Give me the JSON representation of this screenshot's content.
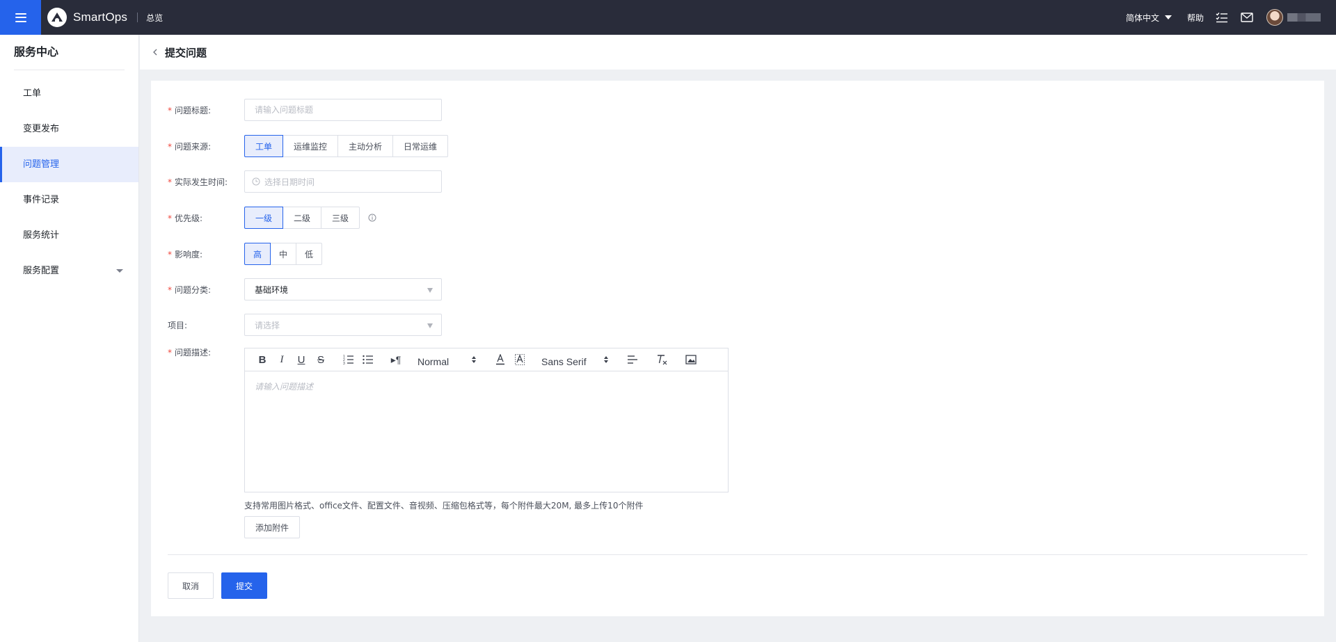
{
  "topbar": {
    "app_name": "SmartOps",
    "nav_overview": "总览",
    "language": "简体中文",
    "help": "帮助"
  },
  "sidebar": {
    "title": "服务中心",
    "items": [
      {
        "label": "工单"
      },
      {
        "label": "变更发布"
      },
      {
        "label": "问题管理"
      },
      {
        "label": "事件记录"
      },
      {
        "label": "服务统计"
      },
      {
        "label": "服务配置"
      }
    ]
  },
  "page": {
    "title": "提交问题"
  },
  "form": {
    "title_label": "问题标题:",
    "title_placeholder": "请输入问题标题",
    "source_label": "问题来源:",
    "source_options": [
      "工单",
      "运维监控",
      "主动分析",
      "日常运维"
    ],
    "source_selected": "工单",
    "time_label": "实际发生时间:",
    "time_placeholder": "选择日期时间",
    "priority_label": "优先级:",
    "priority_options": [
      "一级",
      "二级",
      "三级"
    ],
    "priority_selected": "一级",
    "impact_label": "影响度:",
    "impact_options": [
      "高",
      "中",
      "低"
    ],
    "impact_selected": "高",
    "category_label": "问题分类:",
    "category_value": "基础环境",
    "project_label": "项目:",
    "project_placeholder": "请选择",
    "desc_label": "问题描述:",
    "desc_placeholder": "请输入问题描述",
    "editor_header_value": "Normal",
    "editor_font_value": "Sans Serif",
    "attach_hint": "支持常用图片格式、office文件、配置文件、音视频、压缩包格式等，每个附件最大20M, 最多上传10个附件",
    "attach_button": "添加附件",
    "cancel_button": "取消",
    "submit_button": "提交"
  },
  "colors": {
    "accent": "#2563eb",
    "topbar": "#292c3a",
    "required": "#f0483e"
  }
}
